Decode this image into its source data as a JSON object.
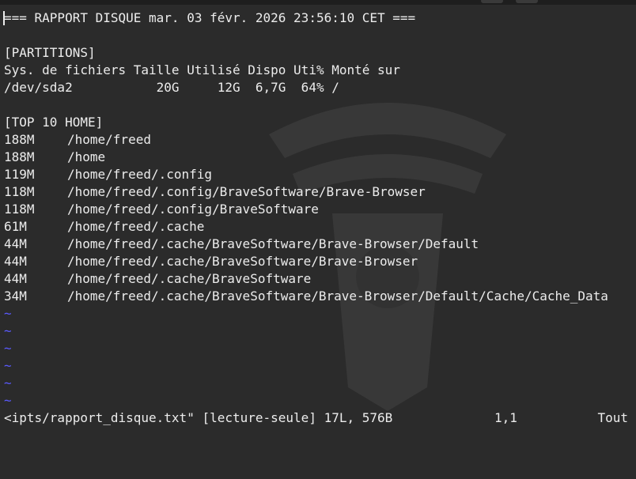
{
  "header": "=== RAPPORT DISQUE mar. 03 févr. 2026 23:56:10 CET ===",
  "partitions": {
    "section_title": "[PARTITIONS]",
    "columns_line": "Sys. de fichiers Taille Utilisé Dispo Uti% Monté sur",
    "row_line": "/dev/sda2           20G     12G  6,7G  64% /"
  },
  "top10": {
    "section_title": "[TOP 10 HOME]",
    "entries": [
      {
        "size": "188M",
        "path": "/home/freed"
      },
      {
        "size": "188M",
        "path": "/home"
      },
      {
        "size": "119M",
        "path": "/home/freed/.config"
      },
      {
        "size": "118M",
        "path": "/home/freed/.config/BraveSoftware/Brave-Browser"
      },
      {
        "size": "118M",
        "path": "/home/freed/.config/BraveSoftware"
      },
      {
        "size": "61M",
        "path": "/home/freed/.cache"
      },
      {
        "size": "44M",
        "path": "/home/freed/.cache/BraveSoftware/Brave-Browser/Default"
      },
      {
        "size": "44M",
        "path": "/home/freed/.cache/BraveSoftware/Brave-Browser"
      },
      {
        "size": "44M",
        "path": "/home/freed/.cache/BraveSoftware"
      },
      {
        "size": "34M",
        "path": "/home/freed/.cache/BraveSoftware/Brave-Browser/Default/Cache/Cache_Data"
      }
    ]
  },
  "empty_line_marker": "~",
  "status": {
    "file": "<ipts/rapport_disque.txt\" [lecture-seule] 17L, 576B",
    "position": "1,1",
    "view": "Tout"
  },
  "colors": {
    "background": "#2b2b2b",
    "text": "#ececec",
    "tilde": "#5a5aff"
  }
}
